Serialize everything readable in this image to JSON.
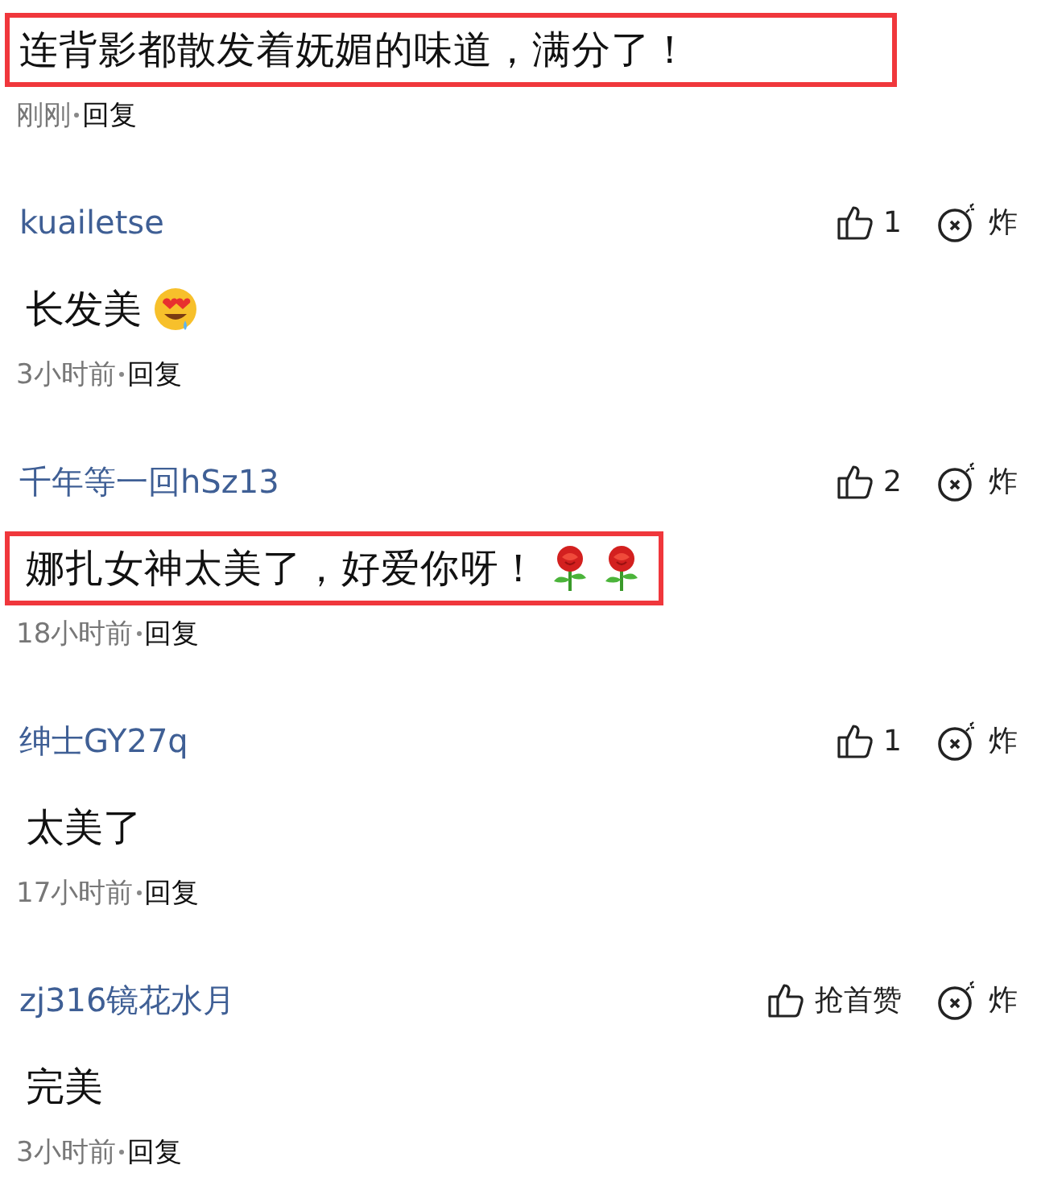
{
  "comments": [
    {
      "text": "连背影都散发着妩媚的味道，满分了！",
      "highlighted": true,
      "time": "刚刚",
      "reply": "回复"
    },
    {
      "user": "kuailetse",
      "likes": "1",
      "bomb": "炸",
      "text": "长发美",
      "highlighted": false,
      "emojis": [
        {
          "kind": "face"
        }
      ],
      "time": "3小时前",
      "reply": "回复"
    },
    {
      "user": "千年等一回hSz13",
      "likes": "2",
      "bomb": "炸",
      "text": "娜扎女神太美了，好爱你呀！",
      "highlighted": true,
      "emojis": [
        {
          "kind": "rose"
        },
        {
          "kind": "rose"
        }
      ],
      "time": "18小时前",
      "reply": "回复"
    },
    {
      "user": "绅士GY27q",
      "likes": "1",
      "bomb": "炸",
      "text": "太美了",
      "highlighted": false,
      "time": "17小时前",
      "reply": "回复"
    },
    {
      "user": "zj316镜花水月",
      "likes": "抢首赞",
      "bomb": "炸",
      "text": "完美",
      "highlighted": false,
      "time": "3小时前",
      "reply": "回复"
    }
  ]
}
